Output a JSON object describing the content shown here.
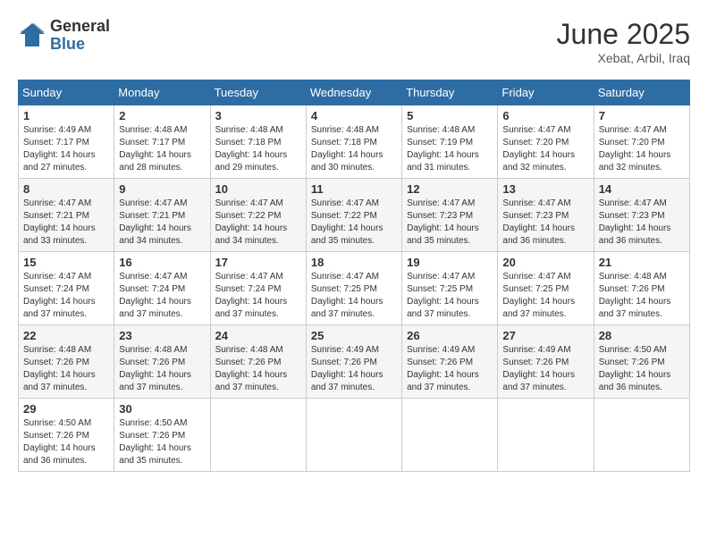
{
  "header": {
    "logo_general": "General",
    "logo_blue": "Blue",
    "month": "June 2025",
    "location": "Xebat, Arbil, Iraq"
  },
  "weekdays": [
    "Sunday",
    "Monday",
    "Tuesday",
    "Wednesday",
    "Thursday",
    "Friday",
    "Saturday"
  ],
  "weeks": [
    [
      {
        "day": "1",
        "sunrise": "4:49 AM",
        "sunset": "7:17 PM",
        "daylight": "14 hours and 27 minutes."
      },
      {
        "day": "2",
        "sunrise": "4:48 AM",
        "sunset": "7:17 PM",
        "daylight": "14 hours and 28 minutes."
      },
      {
        "day": "3",
        "sunrise": "4:48 AM",
        "sunset": "7:18 PM",
        "daylight": "14 hours and 29 minutes."
      },
      {
        "day": "4",
        "sunrise": "4:48 AM",
        "sunset": "7:18 PM",
        "daylight": "14 hours and 30 minutes."
      },
      {
        "day": "5",
        "sunrise": "4:48 AM",
        "sunset": "7:19 PM",
        "daylight": "14 hours and 31 minutes."
      },
      {
        "day": "6",
        "sunrise": "4:47 AM",
        "sunset": "7:20 PM",
        "daylight": "14 hours and 32 minutes."
      },
      {
        "day": "7",
        "sunrise": "4:47 AM",
        "sunset": "7:20 PM",
        "daylight": "14 hours and 32 minutes."
      }
    ],
    [
      {
        "day": "8",
        "sunrise": "4:47 AM",
        "sunset": "7:21 PM",
        "daylight": "14 hours and 33 minutes."
      },
      {
        "day": "9",
        "sunrise": "4:47 AM",
        "sunset": "7:21 PM",
        "daylight": "14 hours and 34 minutes."
      },
      {
        "day": "10",
        "sunrise": "4:47 AM",
        "sunset": "7:22 PM",
        "daylight": "14 hours and 34 minutes."
      },
      {
        "day": "11",
        "sunrise": "4:47 AM",
        "sunset": "7:22 PM",
        "daylight": "14 hours and 35 minutes."
      },
      {
        "day": "12",
        "sunrise": "4:47 AM",
        "sunset": "7:23 PM",
        "daylight": "14 hours and 35 minutes."
      },
      {
        "day": "13",
        "sunrise": "4:47 AM",
        "sunset": "7:23 PM",
        "daylight": "14 hours and 36 minutes."
      },
      {
        "day": "14",
        "sunrise": "4:47 AM",
        "sunset": "7:23 PM",
        "daylight": "14 hours and 36 minutes."
      }
    ],
    [
      {
        "day": "15",
        "sunrise": "4:47 AM",
        "sunset": "7:24 PM",
        "daylight": "14 hours and 37 minutes."
      },
      {
        "day": "16",
        "sunrise": "4:47 AM",
        "sunset": "7:24 PM",
        "daylight": "14 hours and 37 minutes."
      },
      {
        "day": "17",
        "sunrise": "4:47 AM",
        "sunset": "7:24 PM",
        "daylight": "14 hours and 37 minutes."
      },
      {
        "day": "18",
        "sunrise": "4:47 AM",
        "sunset": "7:25 PM",
        "daylight": "14 hours and 37 minutes."
      },
      {
        "day": "19",
        "sunrise": "4:47 AM",
        "sunset": "7:25 PM",
        "daylight": "14 hours and 37 minutes."
      },
      {
        "day": "20",
        "sunrise": "4:47 AM",
        "sunset": "7:25 PM",
        "daylight": "14 hours and 37 minutes."
      },
      {
        "day": "21",
        "sunrise": "4:48 AM",
        "sunset": "7:26 PM",
        "daylight": "14 hours and 37 minutes."
      }
    ],
    [
      {
        "day": "22",
        "sunrise": "4:48 AM",
        "sunset": "7:26 PM",
        "daylight": "14 hours and 37 minutes."
      },
      {
        "day": "23",
        "sunrise": "4:48 AM",
        "sunset": "7:26 PM",
        "daylight": "14 hours and 37 minutes."
      },
      {
        "day": "24",
        "sunrise": "4:48 AM",
        "sunset": "7:26 PM",
        "daylight": "14 hours and 37 minutes."
      },
      {
        "day": "25",
        "sunrise": "4:49 AM",
        "sunset": "7:26 PM",
        "daylight": "14 hours and 37 minutes."
      },
      {
        "day": "26",
        "sunrise": "4:49 AM",
        "sunset": "7:26 PM",
        "daylight": "14 hours and 37 minutes."
      },
      {
        "day": "27",
        "sunrise": "4:49 AM",
        "sunset": "7:26 PM",
        "daylight": "14 hours and 37 minutes."
      },
      {
        "day": "28",
        "sunrise": "4:50 AM",
        "sunset": "7:26 PM",
        "daylight": "14 hours and 36 minutes."
      }
    ],
    [
      {
        "day": "29",
        "sunrise": "4:50 AM",
        "sunset": "7:26 PM",
        "daylight": "14 hours and 36 minutes."
      },
      {
        "day": "30",
        "sunrise": "4:50 AM",
        "sunset": "7:26 PM",
        "daylight": "14 hours and 35 minutes."
      },
      null,
      null,
      null,
      null,
      null
    ]
  ]
}
